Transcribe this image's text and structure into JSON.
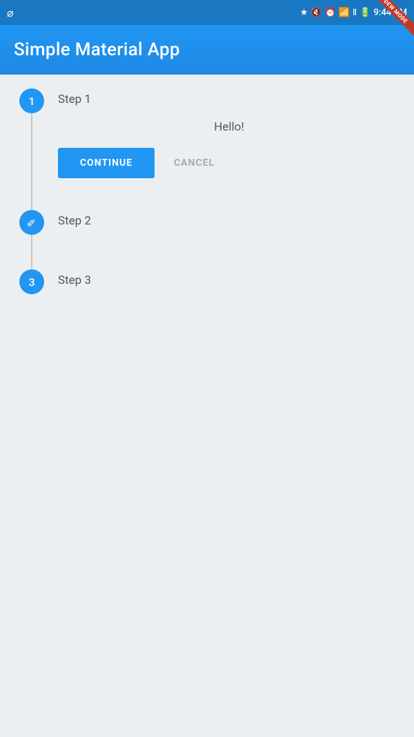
{
  "statusBar": {
    "time": "9:44 PM",
    "dewMode": "DEW MODE"
  },
  "appBar": {
    "title": "Simple Material App"
  },
  "stepper": {
    "steps": [
      {
        "number": "1",
        "label": "Step 1",
        "expanded": true,
        "bodyText": "Hello!",
        "continueLabel": "CONTINUE",
        "cancelLabel": "CANCEL"
      },
      {
        "number": "✏",
        "label": "Step 2",
        "expanded": false,
        "isEdit": true
      },
      {
        "number": "3",
        "label": "Step 3",
        "expanded": false
      }
    ]
  }
}
